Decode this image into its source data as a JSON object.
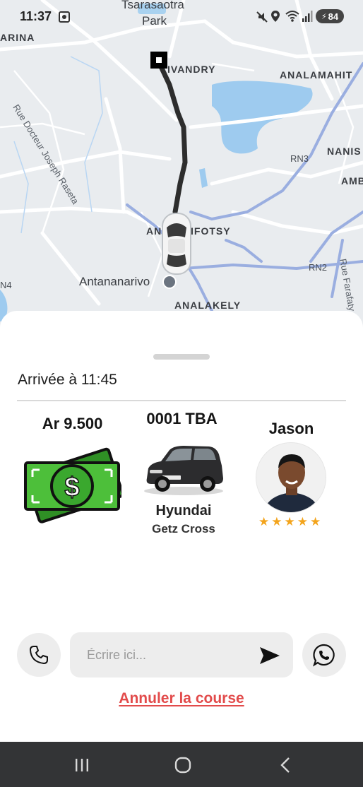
{
  "status_bar": {
    "time": "11:37",
    "battery": "84",
    "icons": [
      "screenshot-icon",
      "mute-icon",
      "location-icon",
      "wifi-icon",
      "signal-icon",
      "battery-charging-icon"
    ]
  },
  "map": {
    "labels": {
      "tsarasaotra_park_top": "Tsarasaotra",
      "tsarasaotra_park_bottom": "Park",
      "arina": "ARINA",
      "ivandry": "IVANDRY",
      "analamahitsy": "ANALAMAHIT",
      "rue_docteur": "Rue Docteur Joseph Raseta",
      "nanisana": "NANIS",
      "rn3": "RN3",
      "ambatomainty": "AMB",
      "ankorondrano_left": "AN",
      "ankorondrano_right": "IFOTSY",
      "antananarivo": "Antananarivo",
      "rn2": "RN2",
      "rn4": "N4",
      "rue_farafaty": "Rue Farafaty",
      "analakely": "ANALAKELY"
    },
    "colors": {
      "route": "#2d2d2d",
      "water": "#9ecbef",
      "highway": "#9aaee0",
      "land": "#e9ecef"
    }
  },
  "trip": {
    "eta": "Arrivée à 11:45",
    "price": "Ar 9.500",
    "plate": "0001 TBA",
    "car_make": "Hyundai",
    "car_model": "Getz Cross",
    "driver_name": "Jason",
    "rating": 5,
    "stars": [
      "★",
      "★",
      "★",
      "★",
      "★"
    ]
  },
  "actions": {
    "message_placeholder": "Écrire ici...",
    "cancel_label": "Annuler la course"
  },
  "colors": {
    "accent_cancel": "#e24b4b",
    "star": "#f3a41c",
    "money_green": "#3aa82e"
  }
}
